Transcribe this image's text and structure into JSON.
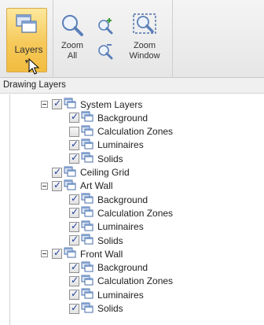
{
  "ribbon": {
    "layers_label": "Layers",
    "caret": "▾",
    "zoom_all_line1": "Zoom",
    "zoom_all_line2": "All",
    "zoom_window_line1": "Zoom",
    "zoom_window_line2": "Window"
  },
  "panel": {
    "title": "Drawing Layers"
  },
  "tree": [
    {
      "label": "System Layers",
      "checked": true,
      "expanded": true,
      "level": 0,
      "children": [
        {
          "label": "Background",
          "checked": true
        },
        {
          "label": "Calculation Zones",
          "checked": false
        },
        {
          "label": "Luminaires",
          "checked": true
        },
        {
          "label": "Solids",
          "checked": true
        }
      ]
    },
    {
      "label": "Ceiling Grid",
      "checked": true,
      "level": 0,
      "children": []
    },
    {
      "label": "Art Wall",
      "checked": true,
      "expanded": true,
      "level": 0,
      "children": [
        {
          "label": "Background",
          "checked": true
        },
        {
          "label": "Calculation Zones",
          "checked": true
        },
        {
          "label": "Luminaires",
          "checked": true
        },
        {
          "label": "Solids",
          "checked": true
        }
      ]
    },
    {
      "label": "Front Wall",
      "checked": true,
      "expanded": true,
      "level": 0,
      "children": [
        {
          "label": "Background",
          "checked": true
        },
        {
          "label": "Calculation Zones",
          "checked": true
        },
        {
          "label": "Luminaires",
          "checked": true
        },
        {
          "label": "Solids",
          "checked": true
        }
      ]
    }
  ],
  "colors": {
    "accent_button": "#f6c95a",
    "checkmark": "#1f3f9a"
  }
}
